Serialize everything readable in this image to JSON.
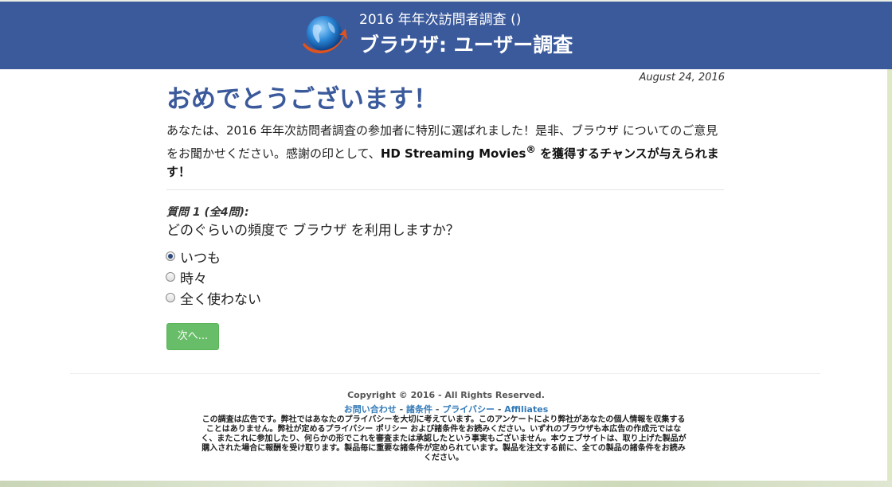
{
  "header": {
    "line1": "2016 年年次訪問者調査 ()",
    "line2": "ブラウザ: ユーザー調査",
    "logo_icon": "globe-arrow-icon"
  },
  "date": "August 24, 2016",
  "main": {
    "title": "おめでとうございます！",
    "intro_part1": "あなたは、2016 年年次訪問者調査の参加者に特別に選ばれました！是非、ブラウザ についてのご意見をお聞かせください。感謝の印として、",
    "intro_prize": "HD Streaming Movies",
    "intro_reg": "®",
    "intro_part2": " を獲得するチャンスが与えられます！"
  },
  "question": {
    "number_label": "質問 1 (全4問):",
    "text": "どのぐらいの頻度で ブラウザ を利用しますか？",
    "options": [
      "いつも",
      "時々",
      "全く使わない"
    ],
    "selected_index": 0
  },
  "next_button": "次へ...",
  "footer": {
    "copyright": "Copyright © 2016 - All Rights Reserved.",
    "link_contact": "お問い合わせ",
    "link_terms": "諸条件",
    "link_privacy": "プライバシー",
    "link_affiliates": "Affiliates",
    "separator": " - ",
    "disclaimer": "この調査は広告です。弊社ではあなたのプライバシーを大切に考えています。このアンケートにより弊社があなたの個人情報を収集することはありません。弊社が定めるプライバシー ポリシー および諸条件をお読みください。いずれのブラウザも本広告の作成元ではなく、またこれに参加したり、何らかの形でこれを審査または承認したという事実もございません。本ウェブサイトは、取り上げた製品が購入された場合に報酬を受け取ります。製品毎に重要な諸条件が定められています。製品を注文する前に、全ての製品の諸条件をお読みください。"
  },
  "colors": {
    "header_bg": "#3b5a9b",
    "title": "#3b5a9b",
    "button_green": "#5cb85c",
    "link": "#337ab7"
  }
}
